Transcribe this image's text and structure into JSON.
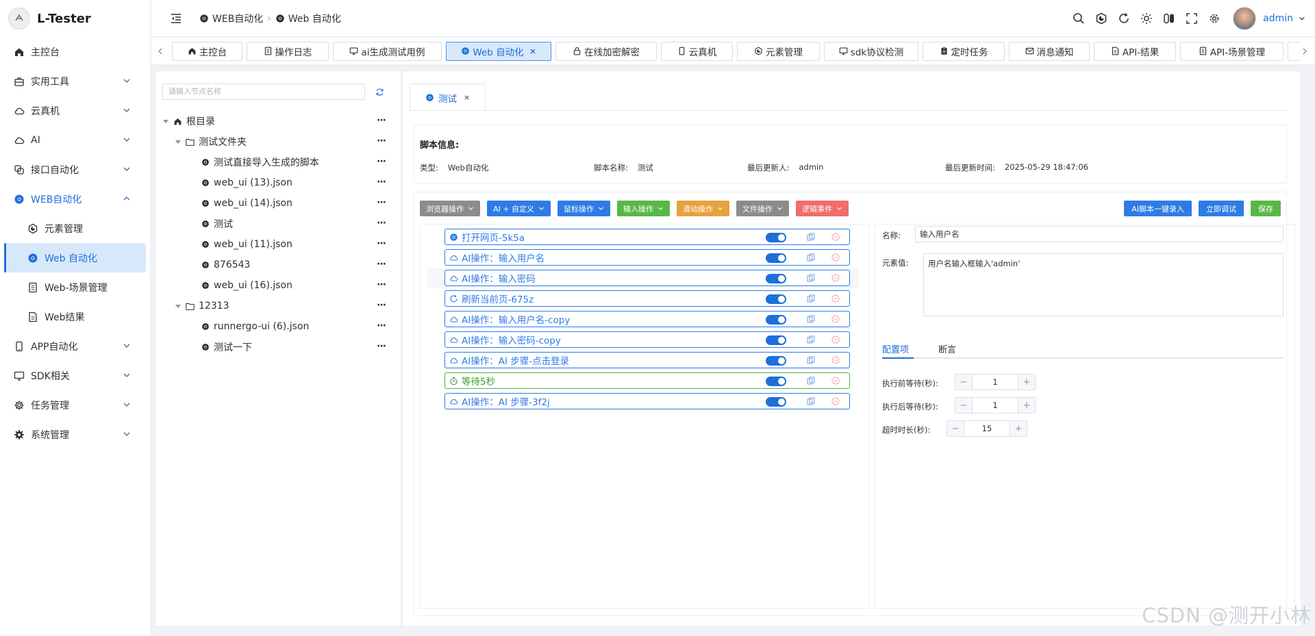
{
  "app": {
    "name": "L-Tester"
  },
  "sidebar": {
    "items": [
      {
        "label": "主控台",
        "icon": "home-icon"
      },
      {
        "label": "实用工具",
        "icon": "toolbox-icon"
      },
      {
        "label": "云真机",
        "icon": "cloud-icon"
      },
      {
        "label": "AI",
        "icon": "cloud-icon"
      },
      {
        "label": "接口自动化",
        "icon": "link-icon"
      },
      {
        "label": "WEB自动化",
        "icon": "chrome-icon"
      },
      {
        "label": "元素管理",
        "icon": "element-icon"
      },
      {
        "label": "Web 自动化",
        "icon": "chrome-icon"
      },
      {
        "label": "Web-场景管理",
        "icon": "document-icon"
      },
      {
        "label": "Web结果",
        "icon": "document-icon"
      },
      {
        "label": "APP自动化",
        "icon": "phone-icon"
      },
      {
        "label": "SDK相关",
        "icon": "monitor-icon"
      },
      {
        "label": "任务管理",
        "icon": "gear-icon"
      },
      {
        "label": "系统管理",
        "icon": "gear-icon"
      }
    ]
  },
  "header": {
    "breadcrumb": [
      "WEB自动化",
      "Web 自动化"
    ],
    "user": "admin"
  },
  "tabs": [
    {
      "label": "主控台"
    },
    {
      "label": "操作日志"
    },
    {
      "label": "ai生成测试用例"
    },
    {
      "label": "Web 自动化"
    },
    {
      "label": "在线加密解密"
    },
    {
      "label": "云真机"
    },
    {
      "label": "元素管理"
    },
    {
      "label": "sdk协议检测"
    },
    {
      "label": "定时任务"
    },
    {
      "label": "消息通知"
    },
    {
      "label": "API-结果"
    },
    {
      "label": "API-场景管理"
    }
  ],
  "tree": {
    "search_placeholder": "请输入节点名称",
    "nodes": [
      {
        "label": "根目录"
      },
      {
        "label": "测试文件夹"
      },
      {
        "label": "测试直接导入生成的脚本"
      },
      {
        "label": "web_ui (13).json"
      },
      {
        "label": "web_ui (14).json"
      },
      {
        "label": "测试"
      },
      {
        "label": "web_ui (11).json"
      },
      {
        "label": "876543"
      },
      {
        "label": "web_ui (16).json"
      },
      {
        "label": "12313"
      },
      {
        "label": "runnergo-ui (6).json"
      },
      {
        "label": "测试一下"
      }
    ]
  },
  "file_tab": {
    "label": "测试"
  },
  "script_info": {
    "title": "脚本信息:",
    "type_label": "类型:",
    "type_value": "Web自动化",
    "name_label": "脚本名称:",
    "name_value": "测试",
    "updater_label": "最后更新人:",
    "updater_value": "admin",
    "time_label": "最后更新时间:",
    "time_value": "2025-05-29 18:47:06"
  },
  "toolbar": {
    "buttons": [
      {
        "label": "浏览器操作",
        "color": "#8c8c8c"
      },
      {
        "label": "AI + 自定义",
        "color": "#2f7be6"
      },
      {
        "label": "鼠标操作",
        "color": "#2f7be6"
      },
      {
        "label": "输入操作",
        "color": "#58b847"
      },
      {
        "label": "滑动操作",
        "color": "#e6a23c"
      },
      {
        "label": "文件操作",
        "color": "#8c8c8c"
      },
      {
        "label": "逻辑事件",
        "color": "#f26c6c"
      }
    ],
    "ai_record": "AI脚本一键录入",
    "debug": "立即调试",
    "save": "保存"
  },
  "steps": [
    {
      "label": "打开网页-5k5a",
      "icon": "chrome-icon",
      "enabled": true
    },
    {
      "label": "AI操作：输入用户名",
      "icon": "cloud-icon",
      "enabled": true
    },
    {
      "label": "AI操作：输入密码",
      "icon": "cloud-icon",
      "enabled": true
    },
    {
      "label": "刷新当前页-675z",
      "icon": "refresh-icon",
      "enabled": true
    },
    {
      "label": "AI操作：输入用户名-copy",
      "icon": "cloud-icon",
      "enabled": true
    },
    {
      "label": "AI操作：输入密码-copy",
      "icon": "cloud-icon",
      "enabled": true
    },
    {
      "label": "AI操作：AI 步骤-点击登录",
      "icon": "cloud-icon",
      "enabled": true
    },
    {
      "label": "等待5秒",
      "icon": "timer-icon",
      "enabled": true
    },
    {
      "label": "AI操作：AI 步骤-3f2j",
      "icon": "cloud-icon",
      "enabled": true
    }
  ],
  "props": {
    "name_label": "名称:",
    "name_value": "输入用户名",
    "element_label": "元素值:",
    "element_value": "用户名输入框输入'admin'",
    "tab_config": "配置项",
    "tab_assert": "断言",
    "pre_wait_label": "执行前等待(秒):",
    "pre_wait": "1",
    "post_wait_label": "执行后等待(秒):",
    "post_wait": "1",
    "timeout_label": "超时时长(秒):",
    "timeout": "15"
  },
  "watermark": "CSDN @测开小林"
}
